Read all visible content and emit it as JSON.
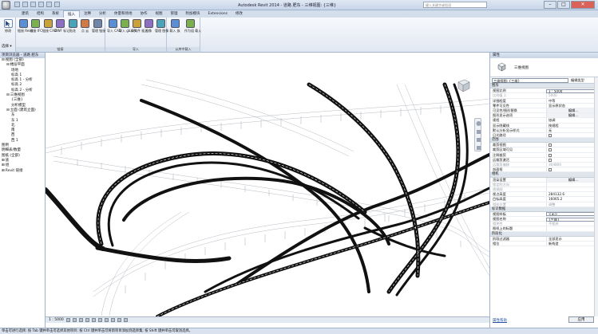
{
  "window": {
    "title": "Autodesk Revit 2014 -  道路  肥东 - 三维视图: {三维}",
    "search_placeholder": "键入关键字或短语"
  },
  "ribbon_tabs": [
    "建筑",
    "结构",
    "系统",
    "插入",
    "注释",
    "分析",
    "体量和场地",
    "协作",
    "视图",
    "管理",
    "附加模块",
    "Extensions",
    "修改"
  ],
  "ribbon_active_tab": "插入",
  "ribbon": {
    "modify_label": "修改",
    "select_label": "选择 ▾",
    "link_group": {
      "label": "链接",
      "buttons": [
        "链接 Revit",
        "链接 IFC",
        "链接 CAD",
        "DWF 标记",
        "贴花",
        "点 云",
        "管理 链接"
      ]
    },
    "import_group": {
      "label": "导入",
      "buttons": [
        "导入 CAD",
        "导入 gbXML",
        "从文件 插入",
        "图像",
        "管理 图像"
      ]
    },
    "family_group": {
      "label": "从库中载入",
      "buttons": [
        "载入 族",
        "作为组 载入"
      ]
    }
  },
  "project_browser": {
    "title": "项目浏览器 - 道路 肥东",
    "items": [
      {
        "level": 0,
        "toggle": "⊟",
        "text": "视图 (全部)"
      },
      {
        "level": 1,
        "toggle": "⊟",
        "text": "楼层平面"
      },
      {
        "level": 2,
        "toggle": "",
        "text": "场地"
      },
      {
        "level": 2,
        "toggle": "",
        "text": "标高 1"
      },
      {
        "level": 2,
        "toggle": "",
        "text": "标高 1 - 分析"
      },
      {
        "level": 2,
        "toggle": "",
        "text": "标高 2"
      },
      {
        "level": 2,
        "toggle": "",
        "text": "标高 2 - 分析"
      },
      {
        "level": 1,
        "toggle": "⊟",
        "text": "三维视图"
      },
      {
        "level": 2,
        "toggle": "",
        "text": "{三维}"
      },
      {
        "level": 2,
        "toggle": "",
        "text": "分析模型"
      },
      {
        "level": 1,
        "toggle": "⊟",
        "text": "立面 (建筑立面)"
      },
      {
        "level": 2,
        "toggle": "",
        "text": "东"
      },
      {
        "level": 2,
        "toggle": "",
        "text": "东 1"
      },
      {
        "level": 2,
        "toggle": "",
        "text": "北"
      },
      {
        "level": 2,
        "toggle": "",
        "text": "南"
      },
      {
        "level": 2,
        "toggle": "",
        "text": "西"
      },
      {
        "level": 2,
        "toggle": "",
        "text": "西 1"
      },
      {
        "level": 0,
        "toggle": "",
        "text": "图例"
      },
      {
        "level": 0,
        "toggle": "",
        "text": "明细表/数量"
      },
      {
        "level": 0,
        "toggle": "",
        "text": "图纸 (全部)"
      },
      {
        "level": 0,
        "toggle": "⊞",
        "text": "族"
      },
      {
        "level": 0,
        "toggle": "⊞",
        "text": "组"
      },
      {
        "level": 0,
        "toggle": "⊞",
        "text": "Revit 链接"
      }
    ]
  },
  "view_control": {
    "scale": "1 : 5000"
  },
  "properties": {
    "title": "属性",
    "type_name": "三维视图",
    "instance_selector": "三维视图: {三维}",
    "edit_type": "编辑类型",
    "rows": [
      {
        "kind": "section",
        "k": "图形"
      },
      {
        "kind": "row",
        "k": "视图比例",
        "v": "1 : 5000",
        "field": true
      },
      {
        "kind": "row",
        "k": "比例值 1:",
        "v": "5000",
        "dim": true
      },
      {
        "kind": "row",
        "k": "详细程度",
        "v": "中等"
      },
      {
        "kind": "row",
        "k": "零件可见性",
        "v": "显示原状态"
      },
      {
        "kind": "row",
        "k": "可见性/图形替换",
        "v": "编辑...",
        "btn": true
      },
      {
        "kind": "row",
        "k": "图形显示选项",
        "v": "编辑...",
        "btn": true
      },
      {
        "kind": "row",
        "k": "规程",
        "v": "協调"
      },
      {
        "kind": "row",
        "k": "显示隐藏线",
        "v": "按规程"
      },
      {
        "kind": "row",
        "k": "默认分析显示样式",
        "v": "无"
      },
      {
        "kind": "row",
        "k": "日光路径",
        "v": "",
        "check": true
      },
      {
        "kind": "section",
        "k": "范围"
      },
      {
        "kind": "row",
        "k": "裁剪视图",
        "v": "",
        "check": true
      },
      {
        "kind": "row",
        "k": "裁剪区域可见",
        "v": "",
        "check": true
      },
      {
        "kind": "row",
        "k": "注释裁剪",
        "v": "",
        "check": true
      },
      {
        "kind": "row",
        "k": "远裁剪激活",
        "v": "",
        "check": true
      },
      {
        "kind": "row",
        "k": "远裁剪偏移",
        "v": "304800",
        "dim": true
      },
      {
        "kind": "row",
        "k": "剖面框",
        "v": "",
        "check": true
      },
      {
        "kind": "section",
        "k": "相机"
      },
      {
        "kind": "row",
        "k": "渲染设置",
        "v": "编辑...",
        "btn": true
      },
      {
        "kind": "row",
        "k": "锁定的方向",
        "v": "",
        "dim": true
      },
      {
        "kind": "row",
        "k": "透视图",
        "v": "",
        "dim": true
      },
      {
        "kind": "row",
        "k": "视点高度",
        "v": "284132.6"
      },
      {
        "kind": "row",
        "k": "目标高度",
        "v": "16065.2"
      },
      {
        "kind": "row",
        "k": "相机位置",
        "v": "调整",
        "dim": true
      },
      {
        "kind": "section",
        "k": "标识数据"
      },
      {
        "kind": "row",
        "k": "视图样板",
        "v": "<无>",
        "field": true
      },
      {
        "kind": "row",
        "k": "视图名称",
        "v": "{三维}",
        "field": true
      },
      {
        "kind": "row",
        "k": "相关性",
        "v": "不相关",
        "dim": true
      },
      {
        "kind": "row",
        "k": "图纸上的标题",
        "v": ""
      },
      {
        "kind": "section",
        "k": "阶段化"
      },
      {
        "kind": "row",
        "k": "阶段过滤器",
        "v": "全部显示"
      },
      {
        "kind": "row",
        "k": "相位",
        "v": "新构造"
      }
    ],
    "help_link": "属性帮助",
    "apply": "应用"
  },
  "status_bar": "单击可进行选择; 按 Tab 键并单击可选择其他项目; 按 Ctrl 键并单击可将新项目添加到选择集; 按 Shift 键并单击可取消选择。"
}
